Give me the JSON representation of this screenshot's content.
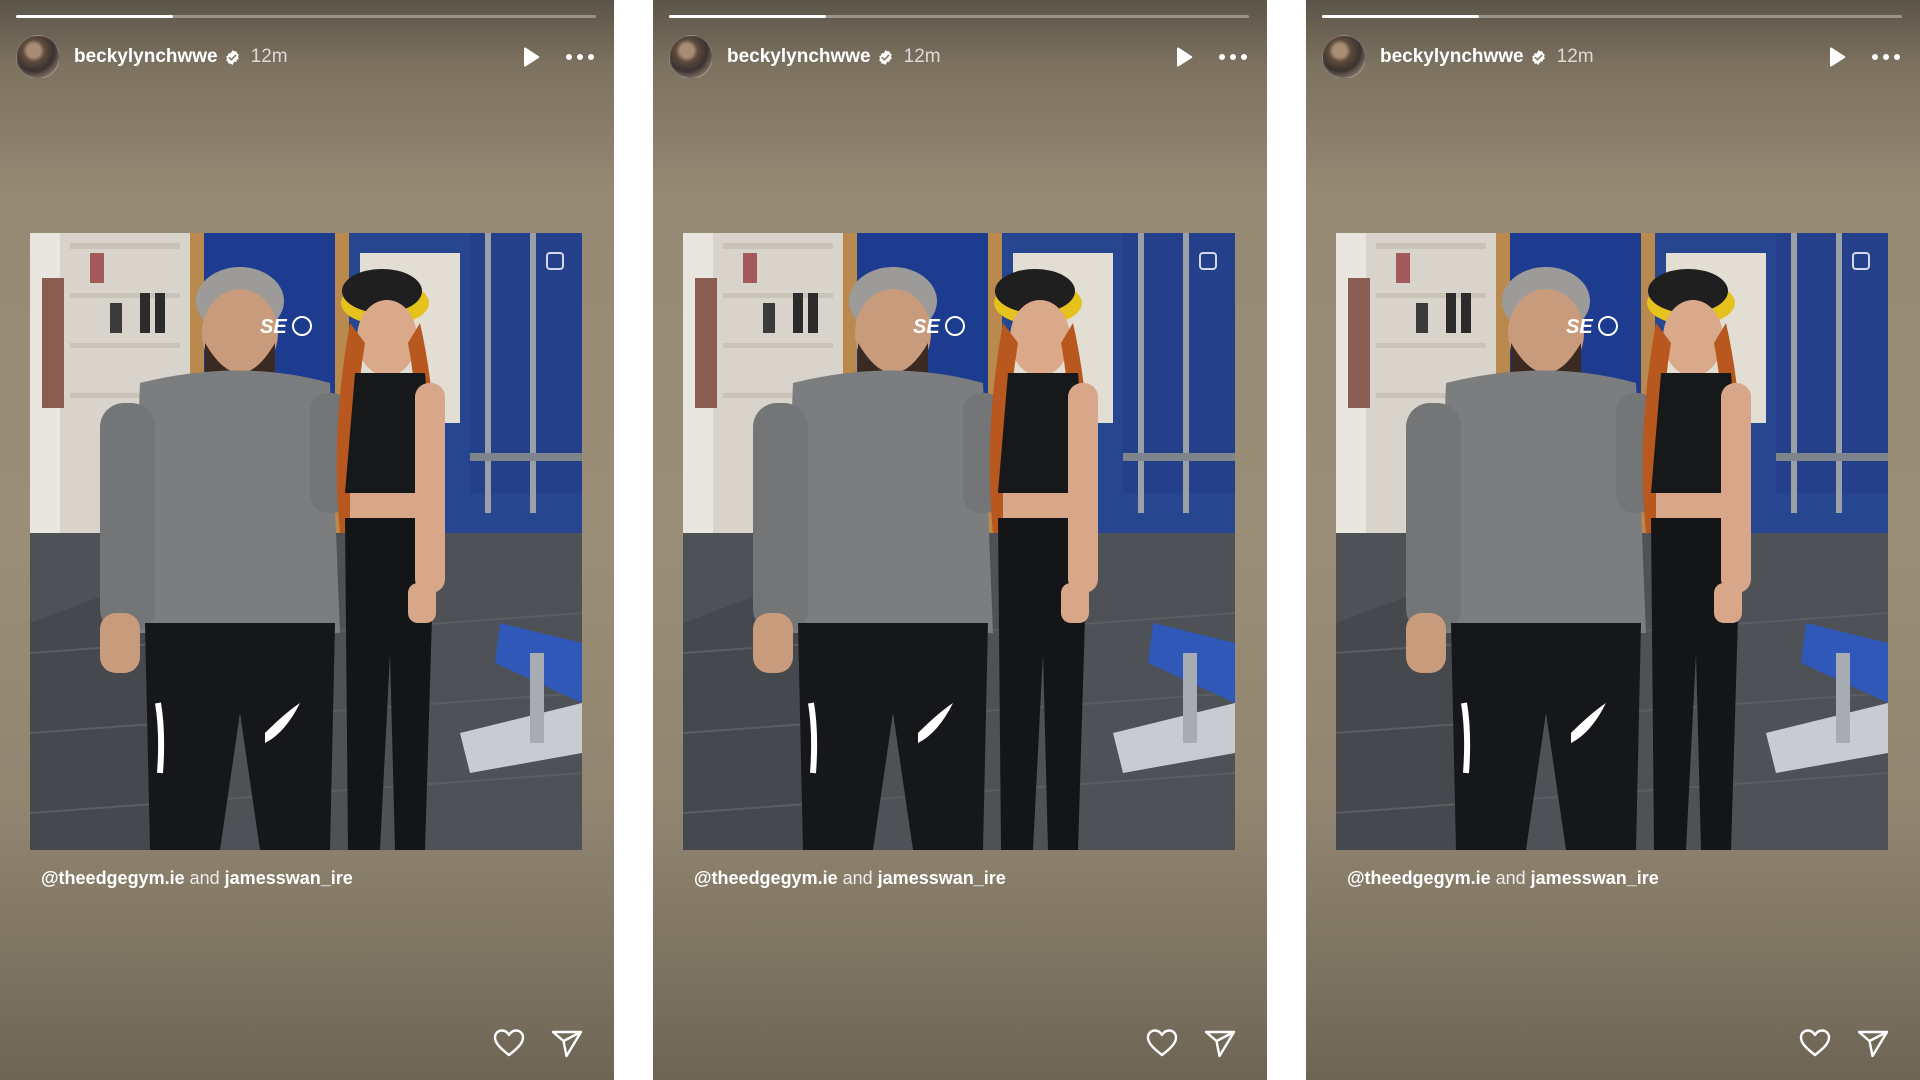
{
  "stories": [
    {
      "username": "beckylynchwwe",
      "time": "12m",
      "progress": 0.27,
      "caption": {
        "mention1": "@theedgegym.ie",
        "joiner": "and",
        "mention2": "jamesswan_ire"
      },
      "icons": [
        "verified-icon",
        "play-icon",
        "more-icon",
        "heart-icon",
        "send-icon"
      ]
    },
    {
      "username": "beckylynchwwe",
      "time": "12m",
      "progress": 0.27,
      "caption": {
        "mention1": "@theedgegym.ie",
        "joiner": "and",
        "mention2": "jamesswan_ire"
      },
      "icons": [
        "verified-icon",
        "play-icon",
        "more-icon",
        "heart-icon",
        "send-icon"
      ]
    },
    {
      "username": "beckylynchwwe",
      "time": "12m",
      "progress": 0.27,
      "caption": {
        "mention1": "@theedgegym.ie",
        "joiner": "and",
        "mention2": "jamesswan_ire"
      },
      "icons": [
        "verified-icon",
        "play-icon",
        "more-icon",
        "heart-icon",
        "send-icon"
      ]
    }
  ],
  "colors": {
    "background_gradient_top": "#5b5448",
    "background_gradient_mid": "#9a8e78",
    "text": "#ffffff",
    "gym_wall_blue": "#1d3c8f"
  }
}
